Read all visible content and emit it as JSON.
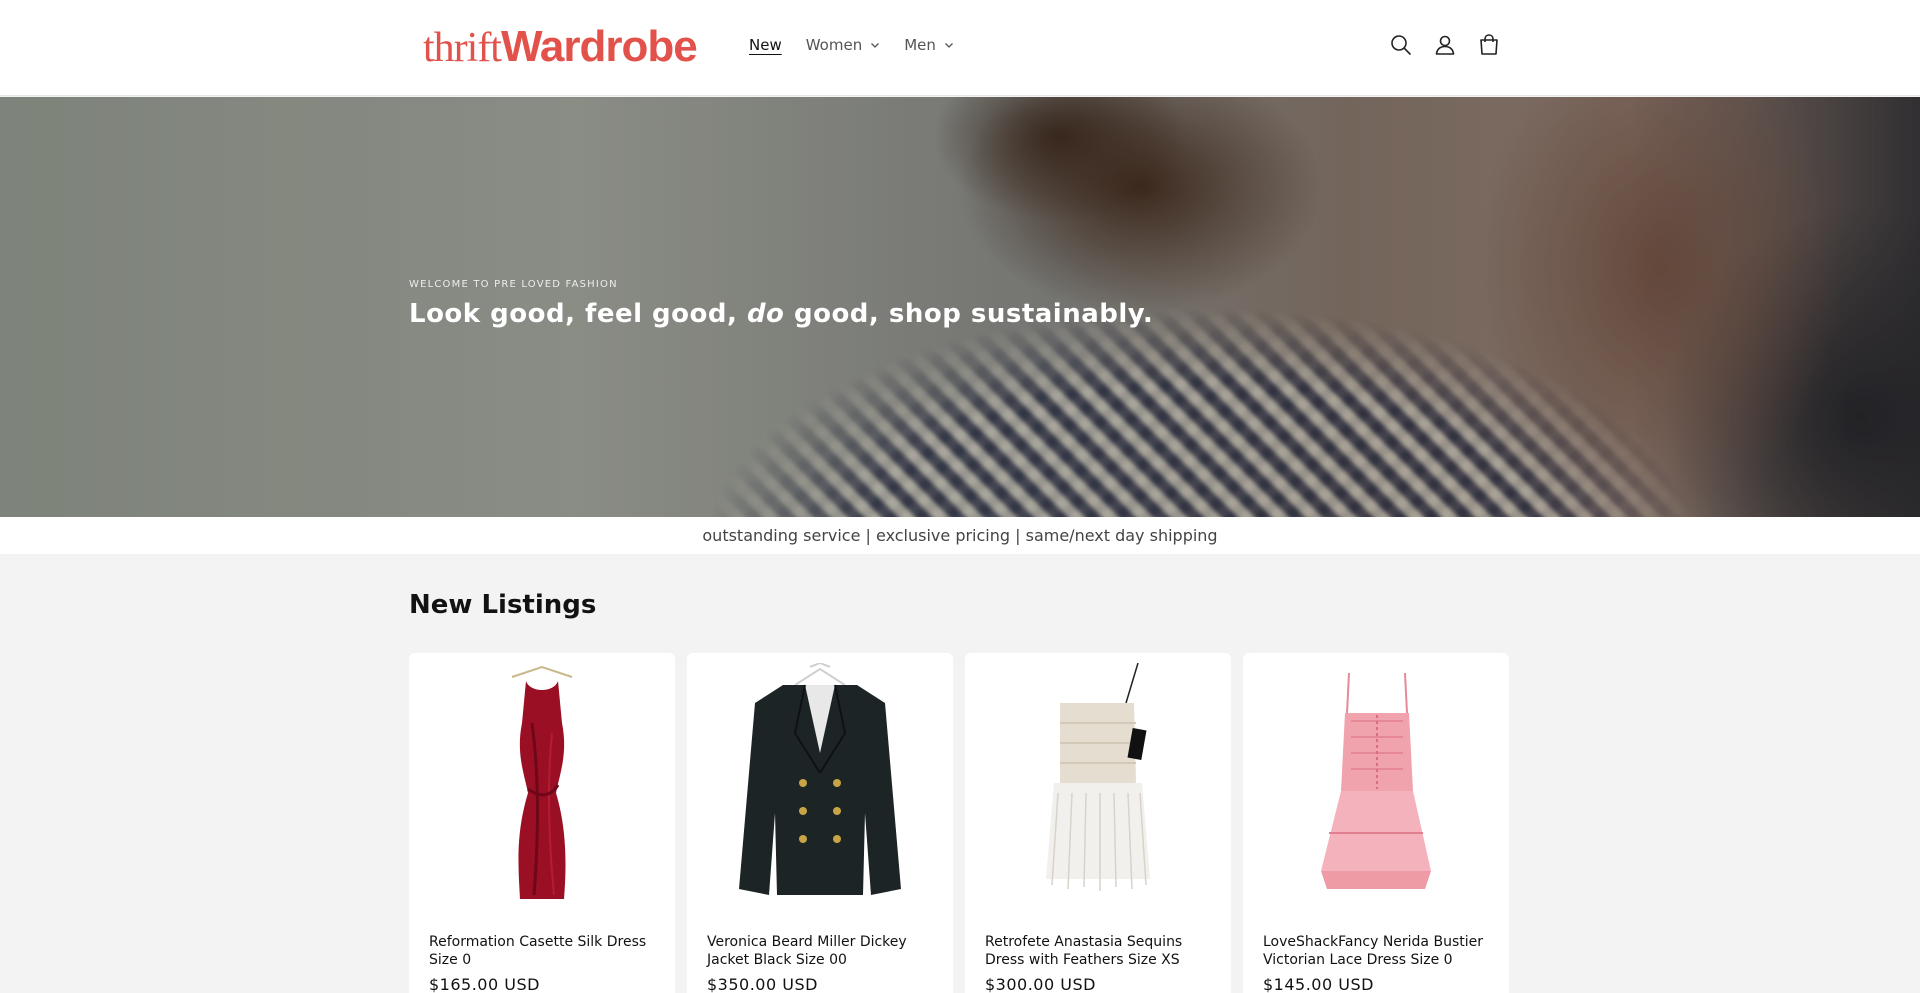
{
  "header": {
    "logo_thin": "thrift",
    "logo_bold": "Wardrobe",
    "nav": [
      {
        "label": "New",
        "active": true
      },
      {
        "label": "Women",
        "dropdown": true
      },
      {
        "label": "Men",
        "dropdown": true
      }
    ],
    "icons": [
      "search-icon",
      "account-icon",
      "cart-icon"
    ],
    "brand_color": "#e2524a"
  },
  "hero": {
    "kicker": "WELCOME TO PRE LOVED FASHION",
    "title_before": "Look good, feel good, ",
    "title_emphasis": "do",
    "title_after": " good, shop sustainably."
  },
  "announcement": "outstanding service | exclusive pricing | same/next day shipping",
  "listings": {
    "title": "New Listings",
    "products": [
      {
        "title": "Reformation Casette Silk Dress Size 0",
        "price": "$165.00 USD",
        "color": "#9b0f24"
      },
      {
        "title": "Veronica Beard Miller Dickey Jacket Black Size 00",
        "price": "$350.00 USD",
        "color": "#1c2426"
      },
      {
        "title": "Retrofete Anastasia Sequins Dress with Feathers Size XS",
        "price": "$300.00 USD",
        "color": "#e9e4dc"
      },
      {
        "title": "LoveShackFancy Nerida Bustier Victorian Lace Dress Size 0",
        "price": "$145.00 USD",
        "color": "#f0a3ad"
      }
    ]
  }
}
